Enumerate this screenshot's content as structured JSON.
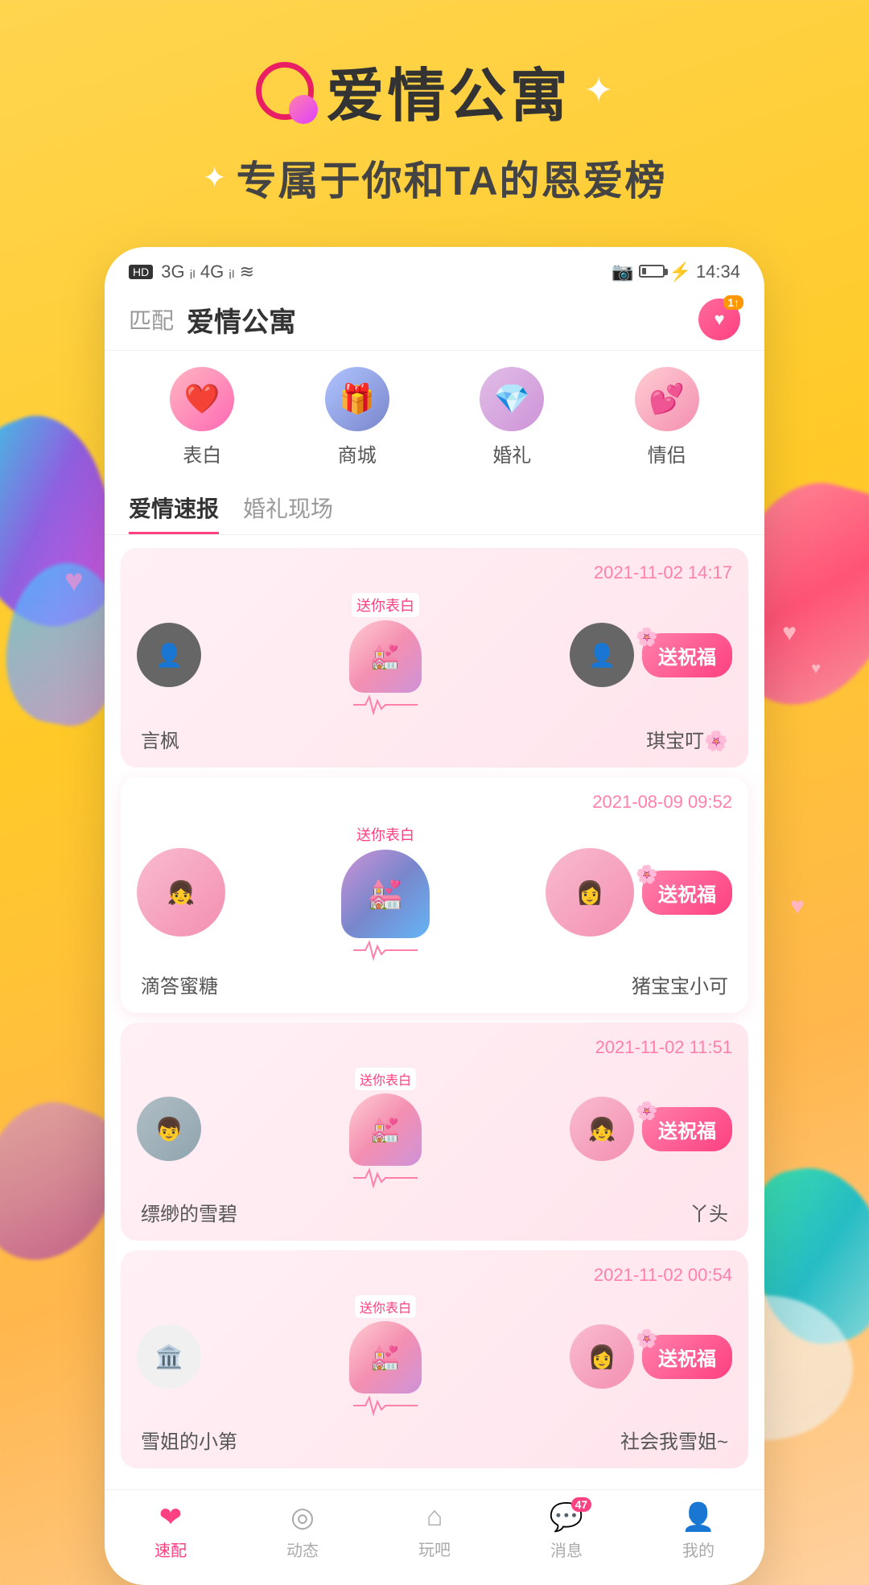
{
  "app": {
    "title": "爱情公寓",
    "subtitle": "专属于你和TA的恩爱榜",
    "logo_label": "logo"
  },
  "status_bar": {
    "left": "HD 2  3G  4G  WiFi",
    "hd": "HD",
    "time": "14:34",
    "battery": "15"
  },
  "app_header": {
    "back_label": "匹配",
    "title": "爱情公寓",
    "badge": "1↑"
  },
  "quick_actions": [
    {
      "label": "表白",
      "icon": "❤️",
      "color_class": "qa-pink"
    },
    {
      "label": "商城",
      "icon": "🎁",
      "color_class": "qa-blue"
    },
    {
      "label": "婚礼",
      "icon": "💎",
      "color_class": "qa-purple"
    },
    {
      "label": "情侣",
      "icon": "💕",
      "color_class": "qa-lpink"
    }
  ],
  "tabs": [
    {
      "label": "爱情速报",
      "active": true
    },
    {
      "label": "婚礼现场",
      "active": false
    }
  ],
  "feed_cards": [
    {
      "time": "2021-11-02 14:17",
      "user1": "言枫",
      "user2": "琪宝叮🌸",
      "btn": "送祝福",
      "avatar1_type": "dark",
      "avatar2_type": "dark"
    },
    {
      "time": "2021-08-09 09:52",
      "user1": "滴答蜜糖",
      "user2": "猪宝宝小可",
      "btn": "送祝福",
      "avatar1_type": "girl",
      "avatar2_type": "girl",
      "large": true
    },
    {
      "time": "2021-11-02 11:51",
      "user1": "缥缈的雪碧",
      "user2": "丫头",
      "btn": "送祝福",
      "avatar1_type": "boy",
      "avatar2_type": "girl"
    },
    {
      "time": "2021-11-02 00:54",
      "user1": "雪姐的小第",
      "user2": "社会我雪姐~",
      "btn": "送祝福",
      "avatar1_type": "light",
      "avatar2_type": "girl"
    }
  ],
  "bottom_nav": [
    {
      "label": "速配",
      "icon": "❤",
      "active": true,
      "badge": null
    },
    {
      "label": "动态",
      "icon": "◎",
      "active": false,
      "badge": null
    },
    {
      "label": "玩吧",
      "icon": "⌂",
      "active": false,
      "badge": null
    },
    {
      "label": "消息",
      "icon": "💬",
      "active": false,
      "badge": "47"
    },
    {
      "label": "我的",
      "icon": "👤",
      "active": false,
      "badge": null
    }
  ],
  "sparkle_top_right": "✦",
  "sparkle_subtitle_left": "✦",
  "sparkle_subtitle_right": "✦"
}
